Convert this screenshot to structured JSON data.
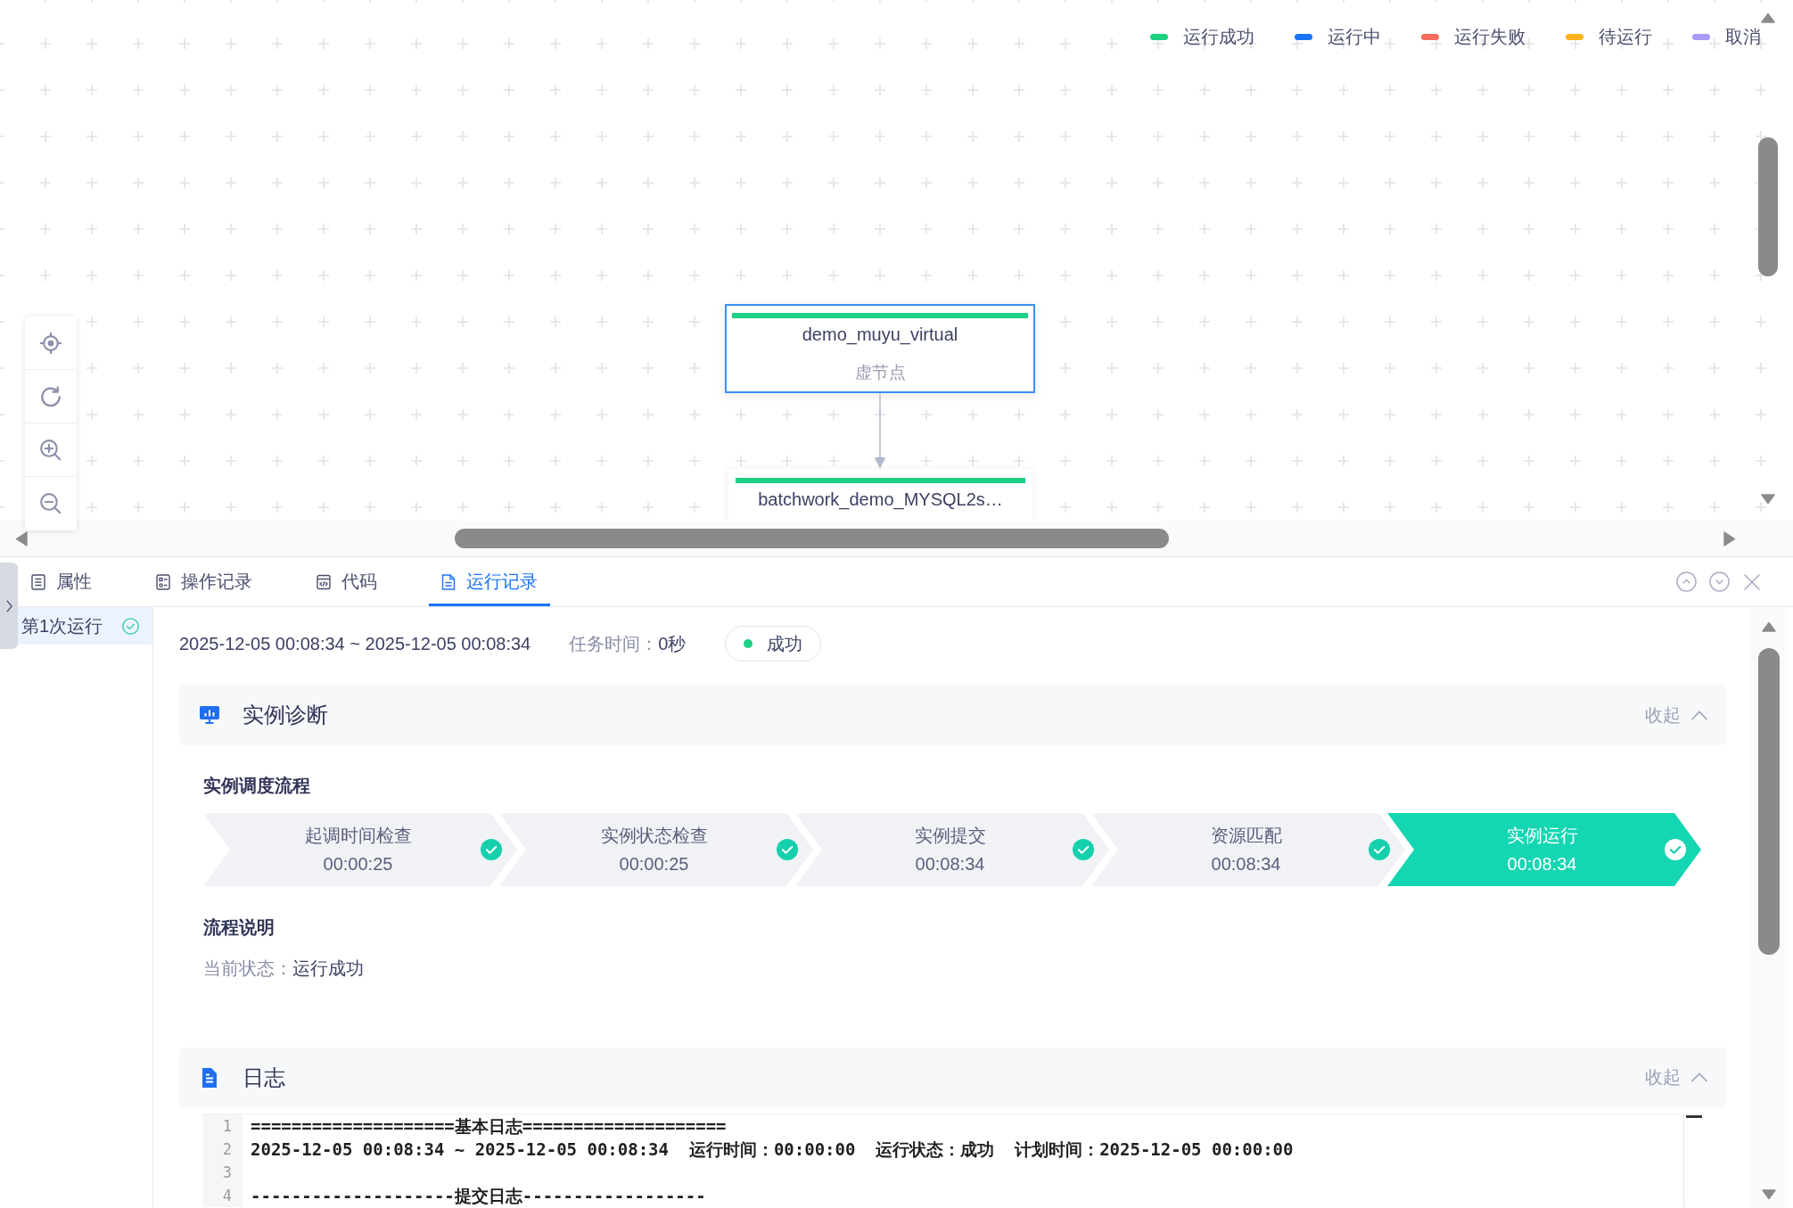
{
  "legend": [
    {
      "label": "运行成功",
      "color": "#1ed083"
    },
    {
      "label": "运行中",
      "color": "#1a73f5"
    },
    {
      "label": "运行失败",
      "color": "#f56c5c"
    },
    {
      "label": "待运行",
      "color": "#fab31e"
    },
    {
      "label": "取消",
      "color": "#a99bf8"
    }
  ],
  "graph": {
    "nodes": [
      {
        "title": "demo_muyu_virtual",
        "subtitle": "虚节点",
        "color": "#1ed083",
        "selected": true
      },
      {
        "title": "batchwork_demo_MYSQL2s…",
        "color": "#1ed083",
        "selected": false
      }
    ]
  },
  "panel": {
    "tabs": [
      {
        "kind": "properties",
        "label": "属性",
        "selected": false
      },
      {
        "kind": "operations",
        "label": "操作记录",
        "selected": false
      },
      {
        "kind": "code",
        "label": "代码",
        "selected": false
      },
      {
        "kind": "runs",
        "label": "运行记录",
        "selected": true
      }
    ],
    "runs": [
      {
        "label": "第1次运行",
        "success": true,
        "selected": true
      }
    ]
  },
  "summary": {
    "time_range": "2025-12-05 00:08:34 ~ 2025-12-05 00:08:34",
    "duration_label": "任务时间：",
    "duration": "0秒",
    "success": true,
    "status_label": "成功"
  },
  "diagnosis": {
    "title": "实例诊断",
    "toggle_label": "收起",
    "expanded": true,
    "flow_title": "实例调度流程",
    "steps": [
      {
        "name": "起调时间检查",
        "time": "00:00:25",
        "done": true,
        "current": false
      },
      {
        "name": "实例状态检查",
        "time": "00:00:25",
        "done": true,
        "current": false
      },
      {
        "name": "实例提交",
        "time": "00:08:34",
        "done": true,
        "current": false
      },
      {
        "name": "资源匹配",
        "time": "00:08:34",
        "done": true,
        "current": false
      },
      {
        "name": "实例运行",
        "time": "00:08:34",
        "done": true,
        "current": true
      }
    ],
    "note_title": "流程说明",
    "state_label": "当前状态：",
    "state_value": "运行成功"
  },
  "log": {
    "title": "日志",
    "toggle_label": "收起",
    "expanded": true,
    "lines": [
      {
        "number": "1",
        "text": "====================基本日志===================="
      },
      {
        "number": "2",
        "text": "2025-12-05 00:08:34 ~ 2025-12-05 00:08:34  运行时间：00:00:00  运行状态：成功  计划时间：2025-12-05 00:00:00"
      },
      {
        "number": "3"
      },
      {
        "number": "4",
        "text": "--------------------提交日志------------------"
      }
    ]
  }
}
